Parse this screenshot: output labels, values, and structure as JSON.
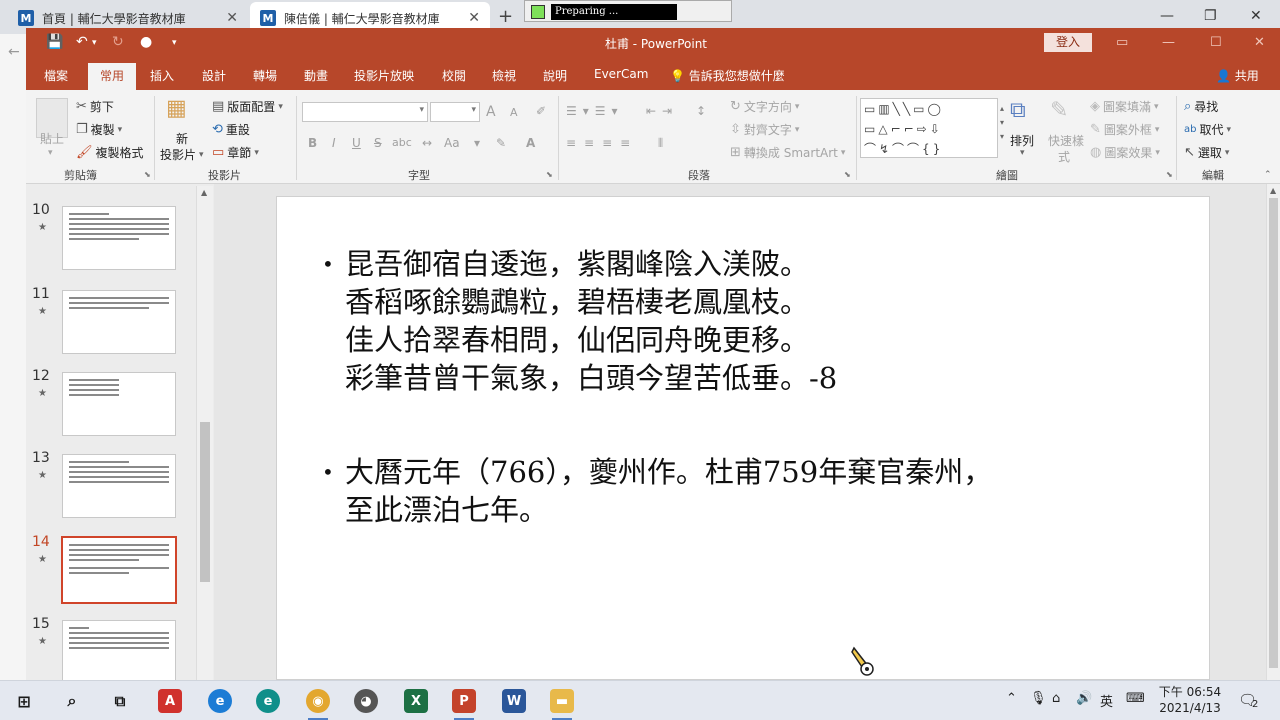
{
  "browser": {
    "tabs": [
      {
        "icon": "M",
        "title": "首頁 | 輔仁大學影音教材庫"
      },
      {
        "icon": "M",
        "title": "陳佶儀 | 輔仁大學影音教材庫"
      }
    ],
    "new_tab": "+",
    "popup_text": "Preparing ..."
  },
  "titlebar": {
    "title": "杜甫 - PowerPoint",
    "login_label": "登入"
  },
  "menu": {
    "items": [
      "檔案",
      "常用",
      "插入",
      "設計",
      "轉場",
      "動畫",
      "投影片放映",
      "校閱",
      "檢視",
      "說明",
      "EverCam"
    ],
    "active": "常用",
    "tell_me": "告訴我您想做什麼",
    "share": "共用"
  },
  "ribbon": {
    "clipboard": {
      "label": "剪貼簿",
      "paste": "貼上",
      "cut": "剪下",
      "copy": "複製",
      "format_painter": "複製格式"
    },
    "slides": {
      "label": "投影片",
      "new_slide_1": "新",
      "new_slide_2": "投影片",
      "layout": "版面配置",
      "reset": "重設",
      "section": "章節"
    },
    "font": {
      "label": "字型",
      "bold": "B",
      "italic": "I",
      "underline": "U",
      "strike": "S",
      "spacing": "abc",
      "case": "Aa",
      "grow": "A",
      "shrink": "A"
    },
    "paragraph": {
      "label": "段落",
      "text_direction": "文字方向",
      "align_text": "對齊文字",
      "smartart": "轉換成 SmartArt"
    },
    "drawing": {
      "label": "繪圖",
      "arrange": "排列",
      "quick_styles_1": "快速樣",
      "quick_styles_2": "式",
      "shape_fill": "圖案填滿",
      "shape_outline": "圖案外框",
      "shape_effects": "圖案效果"
    },
    "editing": {
      "label": "編輯",
      "find": "尋找",
      "replace": "取代",
      "select": "選取"
    }
  },
  "thumbnails": [
    {
      "num": "10",
      "star": "★",
      "active": false
    },
    {
      "num": "11",
      "star": "★",
      "active": false
    },
    {
      "num": "12",
      "star": "★",
      "active": false
    },
    {
      "num": "13",
      "star": "★",
      "active": false
    },
    {
      "num": "14",
      "star": "★",
      "active": true
    },
    {
      "num": "15",
      "star": "★",
      "active": false
    }
  ],
  "slide": {
    "bullet1": [
      "昆吾御宿自逶迤，紫閣峰陰入渼陂。",
      "香稻啄餘鸚鵡粒，碧梧棲老鳳凰枝。",
      "佳人拾翠春相問，仙侶同舟晚更移。",
      "彩筆昔曾干氣象，白頭今望苦低垂。-8"
    ],
    "bullet2": [
      "大曆元年（766），夔州作。杜甫759年棄官秦州，",
      "至此漂泊七年。"
    ]
  },
  "taskbar": {
    "time": "下午 06:54",
    "date": "2021/4/13",
    "ime": "英",
    "notifications": "2"
  },
  "colors": {
    "ppt_accent": "#b7472a",
    "active_thumb": "#d0442a"
  }
}
